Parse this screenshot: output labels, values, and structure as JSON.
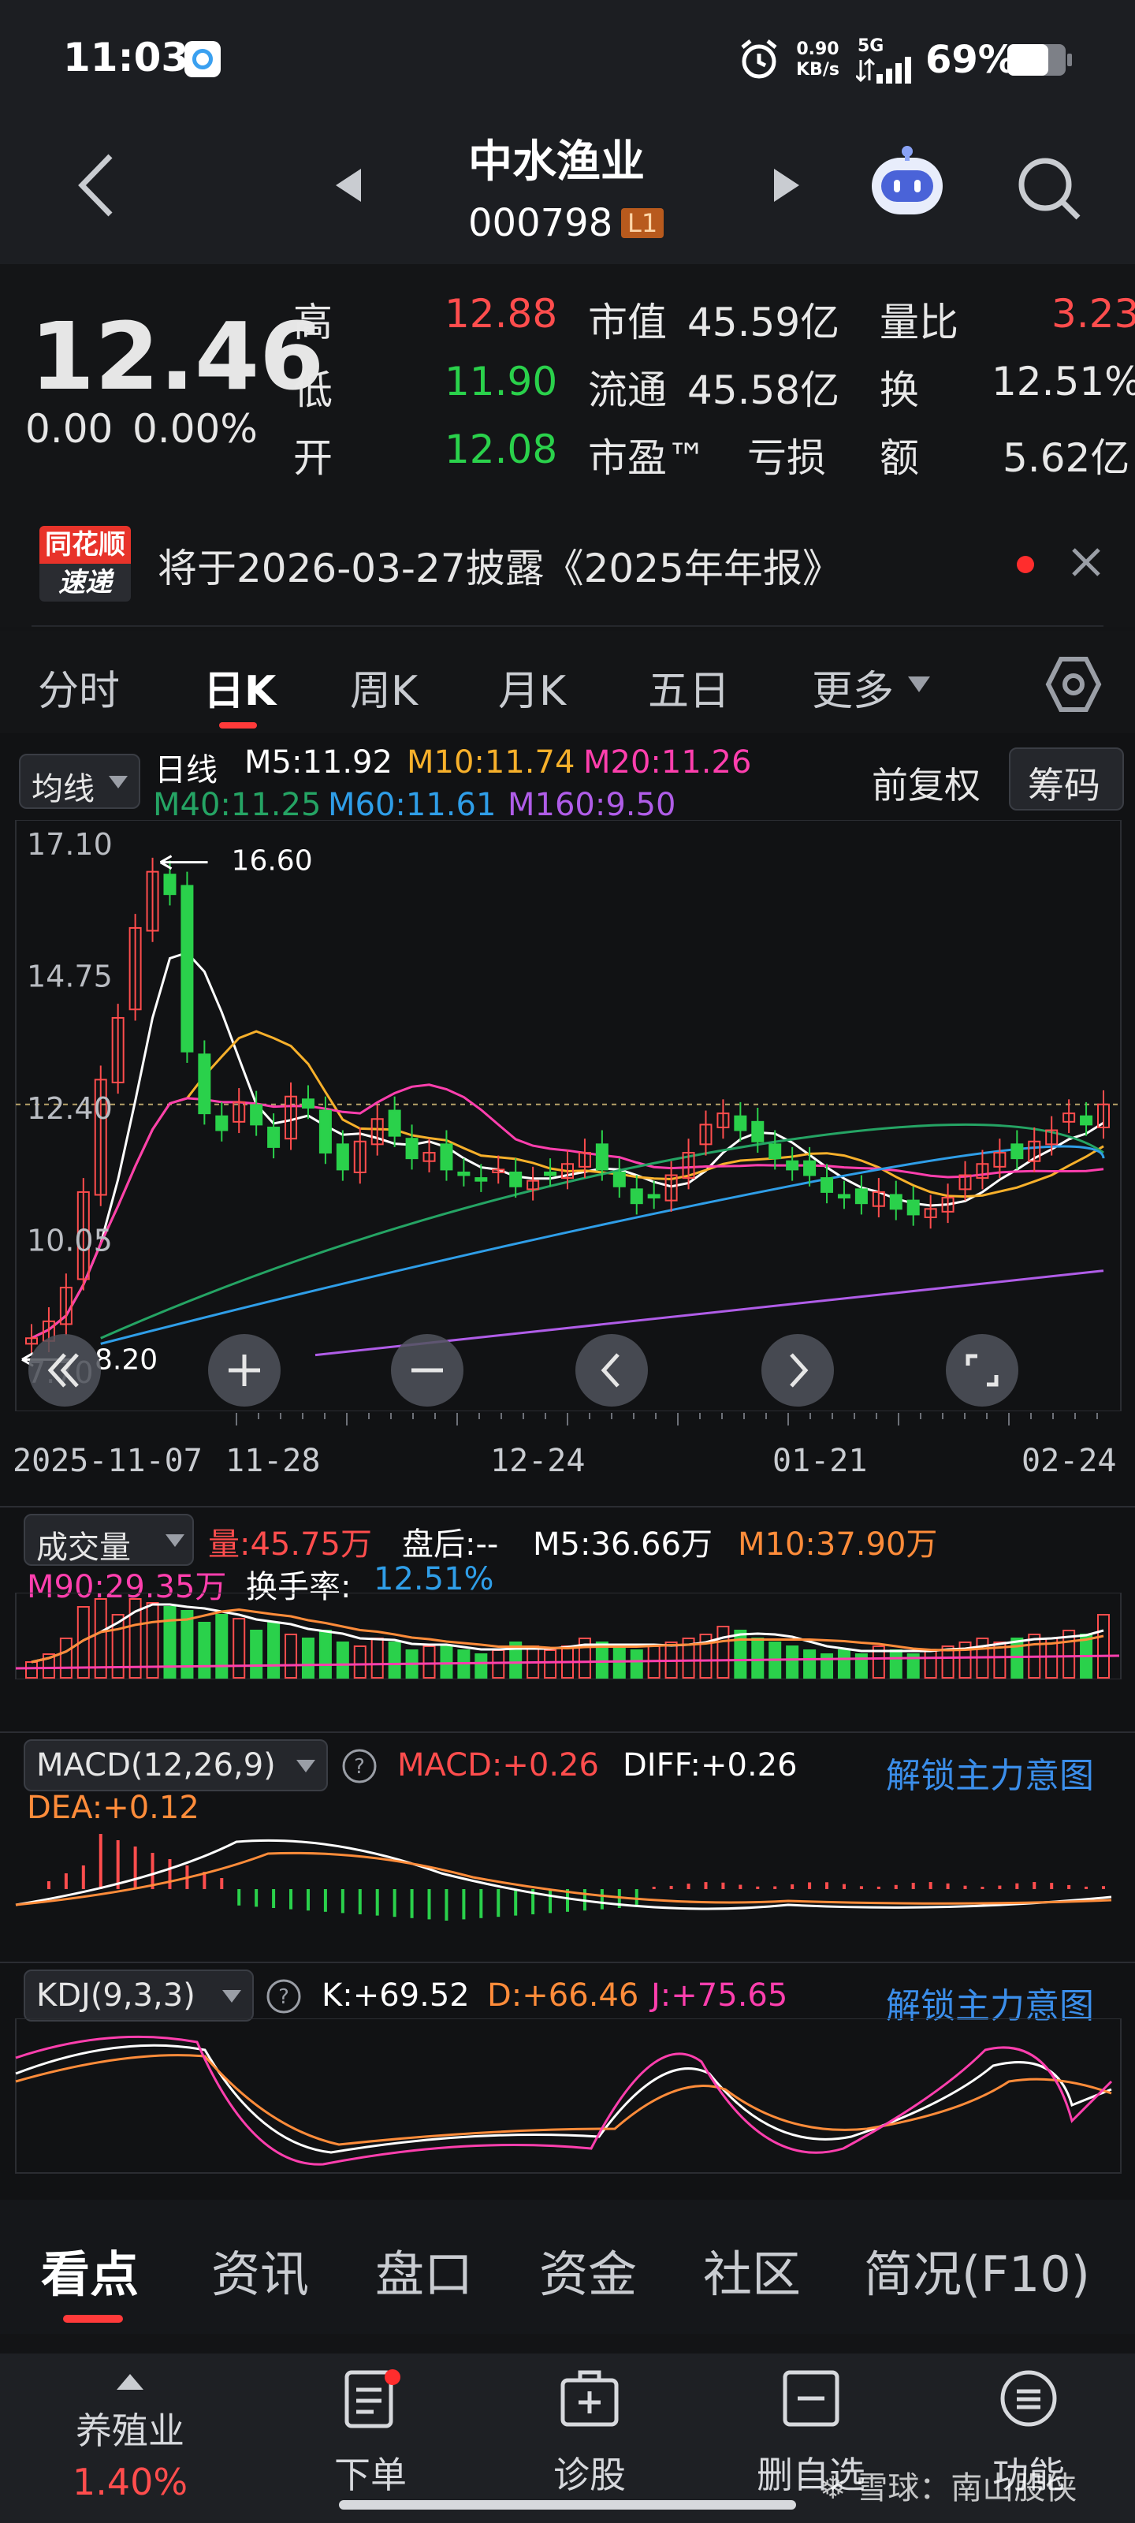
{
  "status_bar": {
    "time": "11:03",
    "net_speed_value": "0.90",
    "net_speed_unit": "KB/s",
    "network": "5G",
    "battery": "69%",
    "icons": [
      "weather-app-icon",
      "alarm-icon",
      "signal-icon",
      "battery-icon"
    ]
  },
  "header": {
    "stock_name": "中水渔业",
    "stock_code": "000798",
    "level_badge": "L1"
  },
  "quote": {
    "price": "12.46",
    "change": "0.00",
    "change_pct": "0.00%",
    "rows": [
      {
        "l1": "高",
        "v1": "12.88",
        "l2": "市值",
        "v2": "45.59亿",
        "l3": "量比",
        "v3": "3.23"
      },
      {
        "l1": "低",
        "v1": "11.90",
        "l2": "流通",
        "v2": "45.58亿",
        "l3": "换",
        "v3": "12.51%"
      },
      {
        "l1": "开",
        "v1": "12.08",
        "l2": "市盈™",
        "v2": "亏损",
        "l3": "额",
        "v3": "5.62亿"
      }
    ]
  },
  "notice": {
    "logo_line1": "同花顺",
    "logo_line2": "速递",
    "text": "将于2026-03-27披露《2025年年报》"
  },
  "tabs": {
    "items": [
      "分时",
      "日K",
      "周K",
      "月K",
      "五日",
      "更多"
    ],
    "active": "日K"
  },
  "kline": {
    "ma_selector": "均线",
    "period_label": "日线",
    "ma": {
      "m5": "M5:11.92",
      "m10": "M10:11.74",
      "m20": "M20:11.26",
      "m40": "M40:11.25",
      "m60": "M60:11.61",
      "m160": "M160:9.50"
    },
    "adjust": "前复权",
    "chips": "筹码",
    "y_ticks": [
      "17.10",
      "14.75",
      "12.40",
      "10.05",
      "7.70"
    ],
    "max_mark": "16.60",
    "min_mark": "8.20",
    "x_ticks": [
      "2025-11-07",
      "11-28",
      "12-24",
      "01-21",
      "02-24"
    ]
  },
  "volume": {
    "selector": "成交量",
    "vol": "量:45.75万",
    "after": "盘后:--",
    "m5": "M5:36.66万",
    "m10": "M10:37.90万",
    "m90": "M90:29.35万",
    "turnover_label": "换手率:",
    "turnover": "12.51%"
  },
  "macd": {
    "selector": "MACD(12,26,9)",
    "macd": "MACD:+0.26",
    "diff": "DIFF:+0.26",
    "dea": "DEA:+0.12",
    "unlock": "解锁主力意图"
  },
  "kdj": {
    "selector": "KDJ(9,3,3)",
    "k": "K:+69.52",
    "d": "D:+66.46",
    "j": "J:+75.65",
    "unlock": "解锁主力意图"
  },
  "bottom_tabs": {
    "items": [
      "看点",
      "资讯",
      "盘口",
      "资金",
      "社区",
      "简况(F10)"
    ],
    "active": "看点"
  },
  "bottom_bar": {
    "sector_name": "养殖业",
    "sector_change": "1.40%",
    "order": "下单",
    "diagnose": "诊股",
    "remove": "删自选",
    "functions": "功能",
    "watermark": "雪球：南山股侠"
  },
  "colors": {
    "up": "#ff4d4d",
    "down": "#2ad14b",
    "bg": "#131416",
    "ma5": "#ffffff",
    "ma10": "#f7b02b",
    "ma20": "#ff3fae",
    "ma40": "#25a464",
    "ma60": "#2f9ee8",
    "ma160": "#b05de8"
  }
}
